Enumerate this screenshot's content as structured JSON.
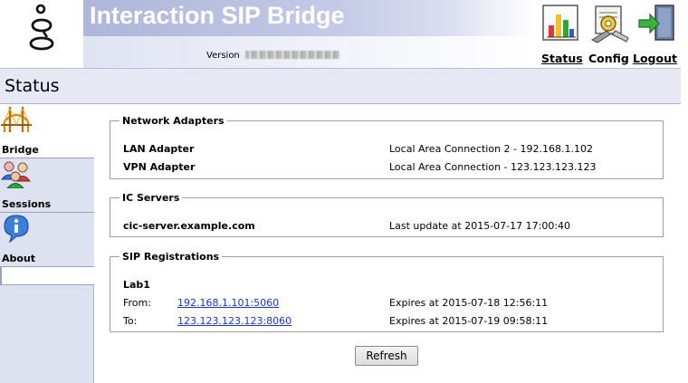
{
  "header": {
    "title": "Interaction SIP Bridge",
    "version_label": "Version",
    "nav": {
      "status": "Status",
      "config": "Config",
      "logout": "Logout"
    },
    "icons": [
      "status-chart-icon",
      "config-tools-icon",
      "logout-door-icon"
    ]
  },
  "page": {
    "title": "Status"
  },
  "sidebar": {
    "items": [
      {
        "label": "Bridge",
        "icon": "bridge-icon",
        "active": true
      },
      {
        "label": "Sessions",
        "icon": "sessions-users-icon",
        "active": false
      },
      {
        "label": "About",
        "icon": "info-icon",
        "active": false
      }
    ]
  },
  "network_adapters": {
    "legend": "Network Adapters",
    "rows": [
      {
        "name": "LAN Adapter",
        "value": "Local Area Connection 2 - 192.168.1.102"
      },
      {
        "name": "VPN Adapter",
        "value": "Local Area Connection - 123.123.123.123"
      }
    ]
  },
  "ic_servers": {
    "legend": "IC Servers",
    "rows": [
      {
        "name": "cic-server.example.com",
        "value": "Last update at 2015-07-17 17:00:40"
      }
    ]
  },
  "sip_registrations": {
    "legend": "SIP Registrations",
    "group_name": "Lab1",
    "rows": [
      {
        "label": "From:",
        "address": "192.168.1.101:5060",
        "expires": "Expires at 2015-07-18 12:56:11"
      },
      {
        "label": "To:",
        "address": "123.123.123.123:8060",
        "expires": "Expires at 2015-07-19 09:58:11"
      }
    ]
  },
  "actions": {
    "refresh": "Refresh"
  },
  "colors": {
    "link": "#1b36c8",
    "sidebar_bg": "#dde1f0",
    "title_bar_bg": "#e6e9f4",
    "banner_title": "#ffffff"
  }
}
